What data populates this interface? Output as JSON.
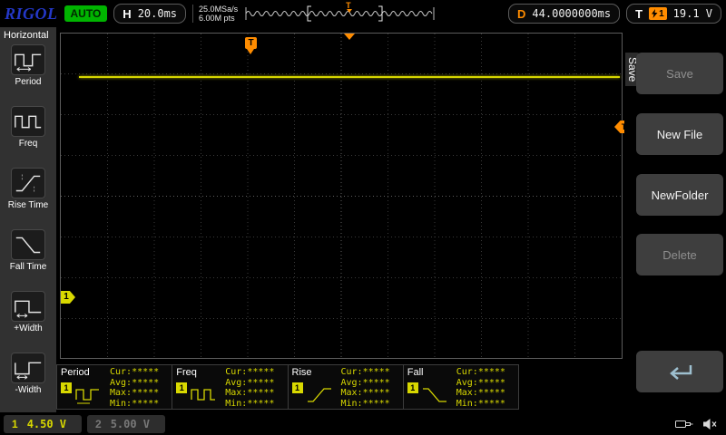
{
  "top_bar": {
    "brand": "RIGOL",
    "run_status": "AUTO",
    "horizontal": {
      "label": "H",
      "value": "20.0ms"
    },
    "sample_rate": "25.0MSa/s",
    "memory_depth": "6.00M pts",
    "trigger_position_marker": "T",
    "delay": {
      "label": "D",
      "value": "44.0000000ms"
    },
    "trigger": {
      "label": "T",
      "source": "1",
      "level": "19.1 V"
    }
  },
  "left_sidebar": {
    "title": "Horizontal",
    "items": [
      {
        "label": "Period",
        "icon": "period-icon"
      },
      {
        "label": "Freq",
        "icon": "freq-icon"
      },
      {
        "label": "Rise Time",
        "icon": "rise-time-icon"
      },
      {
        "label": "Fall Time",
        "icon": "fall-time-icon"
      },
      {
        "label": "+Width",
        "icon": "plus-width-icon"
      },
      {
        "label": "-Width",
        "icon": "minus-width-icon"
      }
    ]
  },
  "scope": {
    "trigger_position_flag": "T",
    "channel1_marker": "1",
    "trigger_level_marker": "T"
  },
  "right_menu": {
    "title": "Save",
    "items": [
      {
        "label": "Save",
        "enabled": false
      },
      {
        "label": "New File",
        "enabled": true
      },
      {
        "label": "NewFolder",
        "enabled": true
      },
      {
        "label": "Delete",
        "enabled": false
      },
      {
        "icon": "return-arrow-icon",
        "enabled": true
      }
    ]
  },
  "measurements": [
    {
      "name": "Period",
      "channel": "1",
      "cur": "Cur:*****",
      "avg": "Avg:*****",
      "max": "Max:*****",
      "min": "Min:*****"
    },
    {
      "name": "Freq",
      "channel": "1",
      "cur": "Cur:*****",
      "avg": "Avg:*****",
      "max": "Max:*****",
      "min": "Min:*****"
    },
    {
      "name": "Rise",
      "channel": "1",
      "cur": "Cur:*****",
      "avg": "Avg:*****",
      "max": "Max:*****",
      "min": "Min:*****"
    },
    {
      "name": "Fall",
      "channel": "1",
      "cur": "Cur:*****",
      "avg": "Avg:*****",
      "max": "Max:*****",
      "min": "Min:*****"
    }
  ],
  "bottom_bar": {
    "channels": [
      {
        "id": "1",
        "value": "4.50 V",
        "active": true
      },
      {
        "id": "2",
        "value": "5.00 V",
        "active": false
      }
    ],
    "icons": [
      "usb-icon",
      "speaker-muted-icon"
    ]
  },
  "colors": {
    "trace_yellow": "#d8d800",
    "trigger_orange": "#ff8c00",
    "brand_blue": "#2438c8",
    "auto_green": "#00b400",
    "disabled_gray": "#8f8f8f"
  }
}
